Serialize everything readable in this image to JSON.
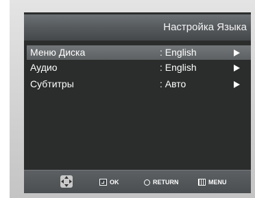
{
  "header": {
    "title": "Настройка Языка"
  },
  "menu": {
    "items": [
      {
        "label": "Меню Диска",
        "value": ": English",
        "arrow_icon": "triangle-right-icon",
        "selected": true
      },
      {
        "label": "Аудио",
        "value": ": English",
        "arrow_icon": "triangle-right-icon",
        "selected": false
      },
      {
        "label": "Субтитры",
        "value": ": Авто",
        "arrow_icon": "triangle-right-icon",
        "selected": false
      }
    ]
  },
  "footer": {
    "navigate_icon": "dpad-icon",
    "ok": {
      "icon": "enter-icon",
      "label": "OK"
    },
    "return": {
      "icon": "return-icon",
      "label": "RETURN"
    },
    "menu": {
      "icon": "menu-icon",
      "label": "MENU"
    }
  },
  "colors": {
    "screen_bg": "#2b2d2d",
    "title_bar": "#565a5d",
    "selection": "#66696b",
    "text": "#ffffff",
    "frame": "#d2d2d2"
  }
}
